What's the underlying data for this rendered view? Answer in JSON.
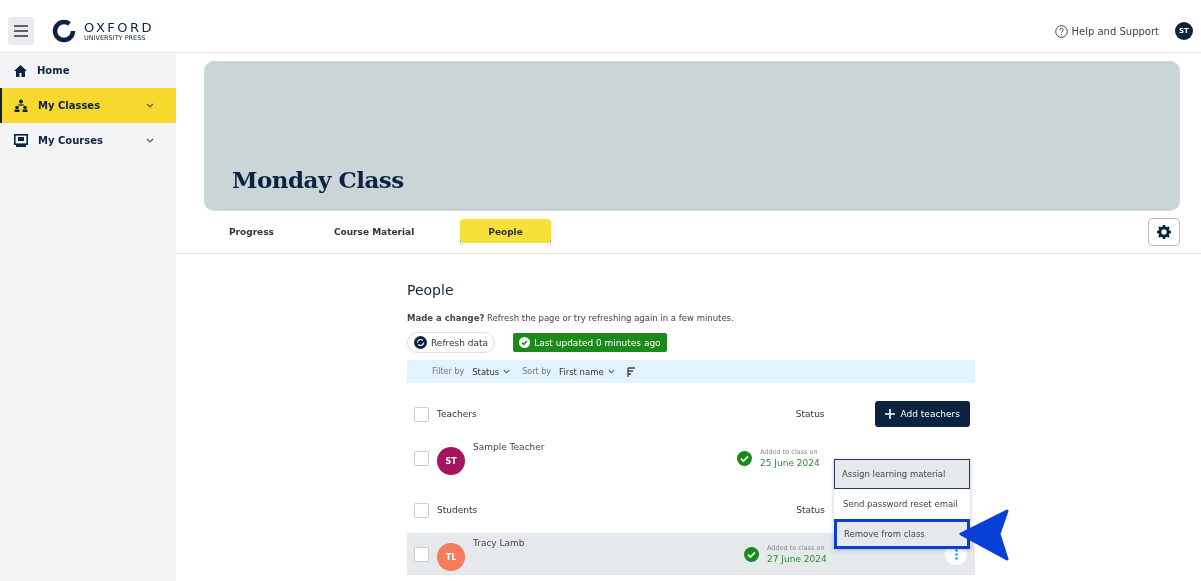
{
  "header": {
    "brand": "OXFORD",
    "brand_sub": "UNIVERSITY PRESS",
    "help": "Help and Support",
    "avatar": "ST"
  },
  "sidebar": {
    "items": [
      {
        "label": "Home",
        "kind": "home",
        "selected": false,
        "expandable": false
      },
      {
        "label": "My Classes",
        "kind": "classes",
        "selected": true,
        "expandable": true
      },
      {
        "label": "My Courses",
        "kind": "courses",
        "selected": false,
        "expandable": true
      }
    ]
  },
  "banner": {
    "title": "Monday Class"
  },
  "tabs": [
    {
      "label": "Progress",
      "selected": false
    },
    {
      "label": "Course Material",
      "selected": false
    },
    {
      "label": "People",
      "selected": true
    }
  ],
  "people": {
    "title": "People",
    "notice": "**Made a change?** Refresh the page or try refreshing again in a few minutes.",
    "refresh": "Refresh data",
    "updated": "Last updated 0 minutes ago",
    "filter_label": "Filter by",
    "filter_value": "Status",
    "sort_label": "Sort by",
    "sort_value": "First name"
  },
  "sections": [
    {
      "title": "Teachers",
      "checked": false,
      "status_heading": "Status",
      "action": "Add teachers",
      "members": [
        {
          "initials": "ST",
          "name": "Sample Teacher",
          "color": "#a3165f",
          "checked": false,
          "added_label": "Added to class on",
          "date": "25 June 2024",
          "highlighted": false,
          "menu_button": false
        }
      ]
    },
    {
      "title": "Students",
      "checked": false,
      "status_heading": "Status",
      "members": [
        {
          "initials": "TL",
          "name": "Tracy Lamb",
          "color": "#f47b5c",
          "checked": false,
          "added_label": "Added to class on",
          "date": "27 June 2024",
          "highlighted": true,
          "menu_button": true
        }
      ]
    }
  ],
  "menu": {
    "items": [
      {
        "label": "Assign learning material",
        "hovered": true,
        "selected": false
      },
      {
        "label": "Send password reset email",
        "hovered": false,
        "selected": false
      },
      {
        "label": "Remove from class",
        "hovered": false,
        "selected": true
      }
    ]
  }
}
